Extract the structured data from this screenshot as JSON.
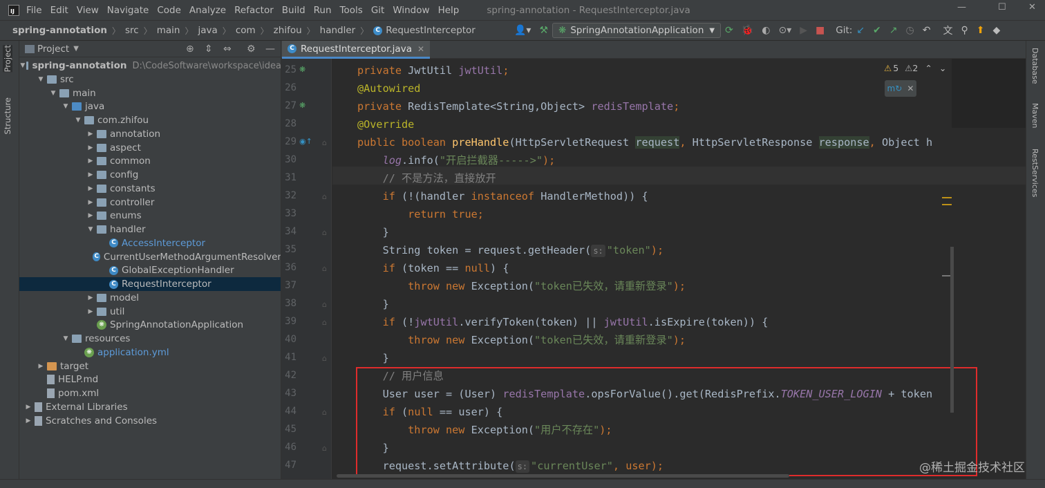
{
  "menubar": {
    "items": [
      "File",
      "Edit",
      "View",
      "Navigate",
      "Code",
      "Analyze",
      "Refactor",
      "Build",
      "Run",
      "Tools",
      "Git",
      "Window",
      "Help"
    ],
    "window_title": "spring-annotation - RequestInterceptor.java"
  },
  "navbar": {
    "breadcrumb": [
      "spring-annotation",
      "src",
      "main",
      "java",
      "com",
      "zhifou",
      "handler",
      "RequestInterceptor"
    ],
    "run_config": "SpringAnnotationApplication",
    "git_label": "Git:"
  },
  "left_tabs": {
    "project": "Project",
    "structure": "Structure"
  },
  "right_tabs": {
    "database": "Database",
    "maven": "Maven",
    "rest": "RestServices"
  },
  "project_panel": {
    "title": "Project",
    "tree": [
      {
        "label": "spring-annotation",
        "path": "D:\\CodeSoftware\\workspace\\idea",
        "depth": 0,
        "arrow": "open",
        "icon": "module",
        "bold": true
      },
      {
        "label": "src",
        "depth": 1,
        "arrow": "open",
        "icon": "folder"
      },
      {
        "label": "main",
        "depth": 2,
        "arrow": "open",
        "icon": "folder"
      },
      {
        "label": "java",
        "depth": 3,
        "arrow": "open",
        "icon": "folder-blue"
      },
      {
        "label": "com.zhifou",
        "depth": 4,
        "arrow": "open",
        "icon": "package"
      },
      {
        "label": "annotation",
        "depth": 5,
        "arrow": "closed",
        "icon": "package"
      },
      {
        "label": "aspect",
        "depth": 5,
        "arrow": "closed",
        "icon": "package"
      },
      {
        "label": "common",
        "depth": 5,
        "arrow": "closed",
        "icon": "package"
      },
      {
        "label": "config",
        "depth": 5,
        "arrow": "closed",
        "icon": "package"
      },
      {
        "label": "constants",
        "depth": 5,
        "arrow": "closed",
        "icon": "package"
      },
      {
        "label": "controller",
        "depth": 5,
        "arrow": "closed",
        "icon": "package"
      },
      {
        "label": "enums",
        "depth": 5,
        "arrow": "closed",
        "icon": "package"
      },
      {
        "label": "handler",
        "depth": 5,
        "arrow": "open",
        "icon": "package"
      },
      {
        "label": "AccessInterceptor",
        "depth": 6,
        "arrow": "none",
        "icon": "class",
        "blue": true
      },
      {
        "label": "CurrentUserMethodArgumentResolver",
        "depth": 6,
        "arrow": "none",
        "icon": "class"
      },
      {
        "label": "GlobalExceptionHandler",
        "depth": 6,
        "arrow": "none",
        "icon": "class"
      },
      {
        "label": "RequestInterceptor",
        "depth": 6,
        "arrow": "none",
        "icon": "class",
        "selected": true
      },
      {
        "label": "model",
        "depth": 5,
        "arrow": "closed",
        "icon": "package"
      },
      {
        "label": "util",
        "depth": 5,
        "arrow": "closed",
        "icon": "package"
      },
      {
        "label": "SpringAnnotationApplication",
        "depth": 5,
        "arrow": "none",
        "icon": "spring"
      },
      {
        "label": "resources",
        "depth": 3,
        "arrow": "open",
        "icon": "folder-res"
      },
      {
        "label": "application.yml",
        "depth": 4,
        "arrow": "none",
        "icon": "yml",
        "blue": true
      },
      {
        "label": "target",
        "depth": 1,
        "arrow": "closed",
        "icon": "folder-orange"
      },
      {
        "label": "HELP.md",
        "depth": 1,
        "arrow": "none",
        "icon": "md"
      },
      {
        "label": "pom.xml",
        "depth": 1,
        "arrow": "none",
        "icon": "maven"
      },
      {
        "label": "External Libraries",
        "depth": 0,
        "arrow": "closed",
        "icon": "libs"
      },
      {
        "label": "Scratches and Consoles",
        "depth": 0,
        "arrow": "closed",
        "icon": "scratch"
      }
    ]
  },
  "editor": {
    "tab_label": "RequestInterceptor.java",
    "inspections": {
      "warnings": "5",
      "weak_warnings": "2"
    },
    "line_numbers": [
      "25",
      "26",
      "27",
      "28",
      "29",
      "30",
      "31",
      "32",
      "33",
      "34",
      "35",
      "36",
      "37",
      "38",
      "39",
      "40",
      "41",
      "42",
      "43",
      "44",
      "45",
      "46",
      "47"
    ],
    "lines": [
      [
        {
          "t": "private ",
          "c": "kw"
        },
        {
          "t": "JwtUtil "
        },
        {
          "t": "jwtUtil",
          "c": "field"
        },
        {
          "t": ";",
          "c": "kw"
        }
      ],
      [
        {
          "t": "@Autowired",
          "c": "ann"
        }
      ],
      [
        {
          "t": "private ",
          "c": "kw"
        },
        {
          "t": "RedisTemplate<String,Object> "
        },
        {
          "t": "redisTemplate",
          "c": "field"
        },
        {
          "t": ";",
          "c": "kw"
        }
      ],
      [
        {
          "t": "@Override",
          "c": "ann"
        }
      ],
      [
        {
          "t": "public boolean ",
          "c": "kw"
        },
        {
          "t": "preHandle",
          "c": "fn"
        },
        {
          "t": "(HttpServletRequest "
        },
        {
          "t": "request",
          "c": "param"
        },
        {
          "t": ", ",
          "c": "kw"
        },
        {
          "t": "HttpServletResponse "
        },
        {
          "t": "response",
          "c": "param"
        },
        {
          "t": ", ",
          "c": "kw"
        },
        {
          "t": "Object h"
        }
      ],
      [
        {
          "t": "    "
        },
        {
          "t": "log",
          "c": "st"
        },
        {
          "t": ".info("
        },
        {
          "t": "\"开启拦截器----->\"",
          "c": "str"
        },
        {
          "t": ");",
          "c": "kw"
        }
      ],
      [
        {
          "t": "    "
        },
        {
          "t": "// 不是方法，直接放开",
          "c": "cmt"
        }
      ],
      [
        {
          "t": "    "
        },
        {
          "t": "if ",
          "c": "kw"
        },
        {
          "t": "(!(handler "
        },
        {
          "t": "instanceof ",
          "c": "kw"
        },
        {
          "t": "HandlerMethod)) {"
        }
      ],
      [
        {
          "t": "        "
        },
        {
          "t": "return true",
          "c": "kw"
        },
        {
          "t": ";",
          "c": "kw"
        }
      ],
      [
        {
          "t": "    }"
        }
      ],
      [
        {
          "t": "    String token = request.getHeader("
        },
        {
          "t": "s:",
          "c": "hint"
        },
        {
          "t": "\"token\"",
          "c": "str"
        },
        {
          "t": ");",
          "c": "kw"
        }
      ],
      [
        {
          "t": "    "
        },
        {
          "t": "if ",
          "c": "kw"
        },
        {
          "t": "(token == "
        },
        {
          "t": "null",
          "c": "kw"
        },
        {
          "t": ") {"
        }
      ],
      [
        {
          "t": "        "
        },
        {
          "t": "throw new ",
          "c": "kw"
        },
        {
          "t": "Exception("
        },
        {
          "t": "\"token已失效，请重新登录\"",
          "c": "str"
        },
        {
          "t": ");",
          "c": "kw"
        }
      ],
      [
        {
          "t": "    }"
        }
      ],
      [
        {
          "t": "    "
        },
        {
          "t": "if ",
          "c": "kw"
        },
        {
          "t": "(!"
        },
        {
          "t": "jwtUtil",
          "c": "field"
        },
        {
          "t": ".verifyToken(token) || "
        },
        {
          "t": "jwtUtil",
          "c": "field"
        },
        {
          "t": ".isExpire(token)) {"
        }
      ],
      [
        {
          "t": "        "
        },
        {
          "t": "throw new ",
          "c": "kw"
        },
        {
          "t": "Exception("
        },
        {
          "t": "\"token已失效，请重新登录\"",
          "c": "str"
        },
        {
          "t": ");",
          "c": "kw"
        }
      ],
      [
        {
          "t": "    }"
        }
      ],
      [
        {
          "t": "    "
        },
        {
          "t": "// 用户信息",
          "c": "cmt"
        }
      ],
      [
        {
          "t": "    User user = (User) "
        },
        {
          "t": "redisTemplate",
          "c": "field"
        },
        {
          "t": ".opsForValue().get(RedisPrefix."
        },
        {
          "t": "TOKEN_USER_LOGIN",
          "c": "st"
        },
        {
          "t": " + token"
        }
      ],
      [
        {
          "t": "    "
        },
        {
          "t": "if ",
          "c": "kw"
        },
        {
          "t": "("
        },
        {
          "t": "null ",
          "c": "kw"
        },
        {
          "t": "== user) {"
        }
      ],
      [
        {
          "t": "        "
        },
        {
          "t": "throw new ",
          "c": "kw"
        },
        {
          "t": "Exception("
        },
        {
          "t": "\"用户不存在\"",
          "c": "str"
        },
        {
          "t": ");",
          "c": "kw"
        }
      ],
      [
        {
          "t": "    }"
        }
      ],
      [
        {
          "t": "    request.setAttribute("
        },
        {
          "t": "s:",
          "c": "hint"
        },
        {
          "t": "\"currentUser\"",
          "c": "str"
        },
        {
          "t": ", user);",
          "c": "kw"
        }
      ]
    ]
  },
  "watermark": "@稀土掘金技术社区",
  "colors": {
    "accent": "#4a88c7",
    "highlight_box": "#e02c2c",
    "selection": "#0d293e"
  }
}
